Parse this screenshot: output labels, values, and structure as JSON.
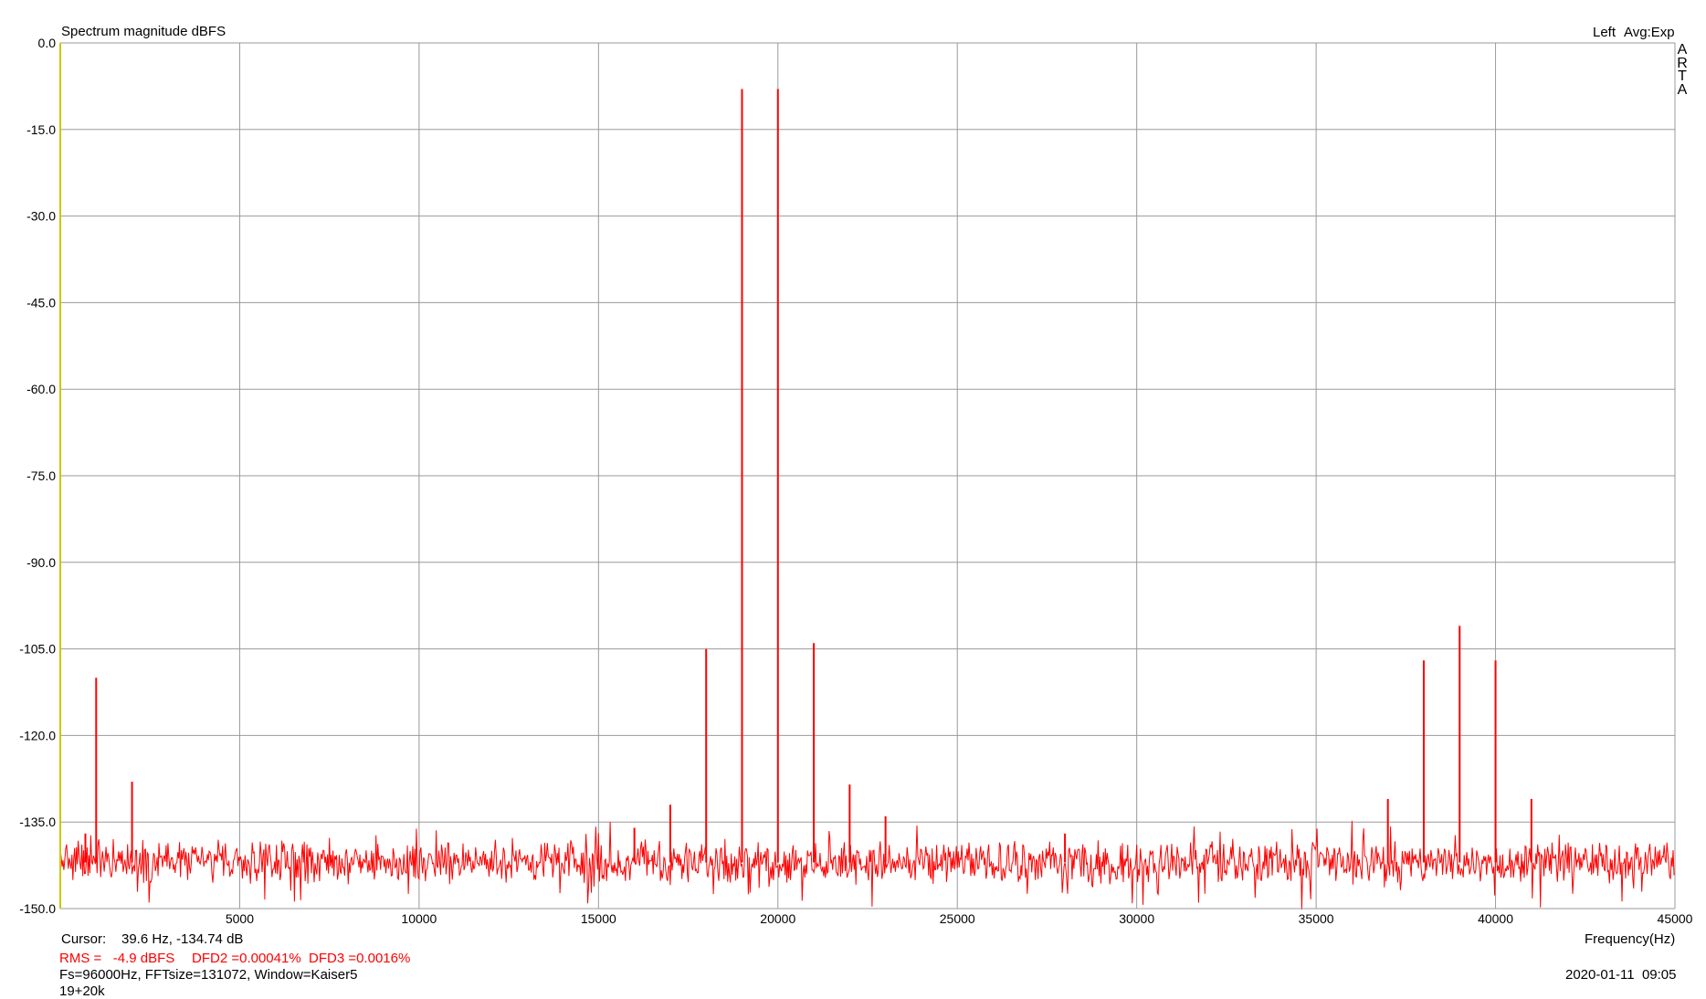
{
  "header": {
    "title": "Spectrum magnitude dBFS",
    "channel": "Left",
    "averaging": "Avg:Exp"
  },
  "brand_letters": [
    "A",
    "R",
    "T",
    "A"
  ],
  "footer": {
    "cursor_label": "Cursor:",
    "cursor_value": "39.6 Hz, -134.74 dB",
    "rms": "RMS =   -4.9 dBFS",
    "dfd": "DFD2 =0.00041%  DFD3 =0.0016%",
    "settings": "Fs=96000Hz, FFTsize=131072, Window=Kaiser5",
    "label": "19+20k",
    "timestamp": "2020-01-11  09:05"
  },
  "colors": {
    "trace": "#ff0000",
    "grid": "#9a9a9a",
    "y_axis": "#c8c800",
    "text_red": "#ff0000"
  },
  "chart_data": {
    "type": "line",
    "title": "Spectrum magnitude dBFS",
    "xlabel": "Frequency(Hz)",
    "ylabel": "",
    "xlim": [
      0,
      45000
    ],
    "ylim": [
      -150,
      0
    ],
    "grid": true,
    "x_ticks": [
      5000,
      10000,
      15000,
      20000,
      25000,
      30000,
      35000,
      40000,
      45000
    ],
    "y_ticks": [
      0,
      -15,
      -30,
      -45,
      -60,
      -75,
      -90,
      -105,
      -120,
      -135,
      -150
    ],
    "y_tick_labels": [
      "0.0",
      "-15.0",
      "-30.0",
      "-45.0",
      "-60.0",
      "-75.0",
      "-90.0",
      "-105.0",
      "-120.0",
      "-135.0",
      "-150.0"
    ],
    "noise_floor_db": -142,
    "series": [
      {
        "peaks": [
          {
            "x": 700,
            "y": -137
          },
          {
            "x": 1000,
            "y": -110
          },
          {
            "x": 2000,
            "y": -128
          },
          {
            "x": 16000,
            "y": -136
          },
          {
            "x": 17000,
            "y": -132
          },
          {
            "x": 18000,
            "y": -105
          },
          {
            "x": 19000,
            "y": -8
          },
          {
            "x": 20000,
            "y": -8
          },
          {
            "x": 21000,
            "y": -104
          },
          {
            "x": 22000,
            "y": -128.5
          },
          {
            "x": 23000,
            "y": -134
          },
          {
            "x": 28000,
            "y": -137
          },
          {
            "x": 37000,
            "y": -131
          },
          {
            "x": 38000,
            "y": -107
          },
          {
            "x": 39000,
            "y": -101
          },
          {
            "x": 40000,
            "y": -107
          },
          {
            "x": 41000,
            "y": -131
          }
        ]
      }
    ]
  }
}
